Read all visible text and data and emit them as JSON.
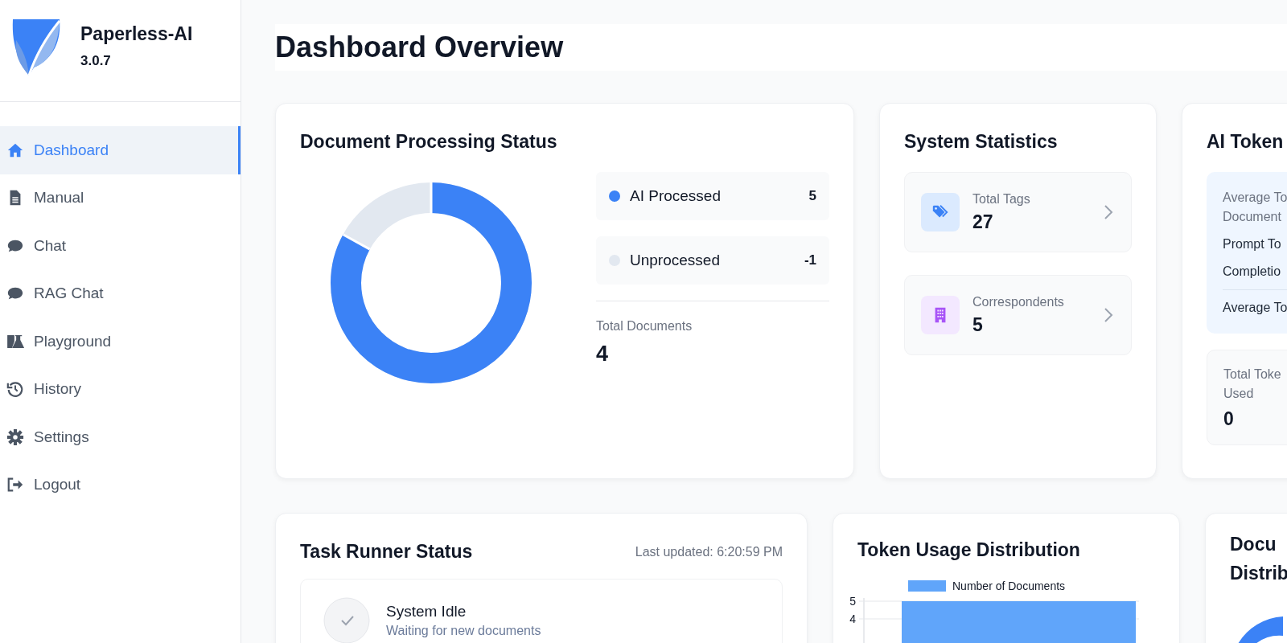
{
  "sidebar": {
    "app_name": "Paperless-AI",
    "version": "3.0.7",
    "items": [
      {
        "label": "Dashboard",
        "kind": "home",
        "selected": true
      },
      {
        "label": "Manual",
        "kind": "document",
        "selected": false
      },
      {
        "label": "Chat",
        "kind": "chat",
        "selected": false
      },
      {
        "label": "RAG Chat",
        "kind": "chat",
        "selected": false
      },
      {
        "label": "Playground",
        "kind": "flask",
        "selected": false
      },
      {
        "label": "History",
        "kind": "history",
        "selected": false
      },
      {
        "label": "Settings",
        "kind": "gear",
        "selected": false
      },
      {
        "label": "Logout",
        "kind": "logout",
        "selected": false
      }
    ]
  },
  "page_title": "Dashboard Overview",
  "document_status": {
    "title": "Document Processing Status",
    "donut": {
      "level": 0.83
    },
    "legend": [
      {
        "label": "AI Processed",
        "count": "5",
        "color": "#3b82f6"
      },
      {
        "label": "Unprocessed",
        "count": "-1",
        "color": "#e2e8f0"
      }
    ],
    "total_label": "Total Documents",
    "total": "4"
  },
  "system_statistics": {
    "title": "System Statistics",
    "items": [
      {
        "kind": "tags",
        "label": "Total Tags",
        "value": "27"
      },
      {
        "kind": "correspondents",
        "label": "Correspondents",
        "value": "5"
      }
    ]
  },
  "ai_tokens": {
    "title": "AI Token",
    "average_lines": [
      "Average To",
      "Document"
    ],
    "rows": [
      "Prompt To",
      "Completio"
    ],
    "footer_row": "Average To",
    "total_lines": [
      "Total Toke",
      "Used"
    ],
    "total_value": "0"
  },
  "task_runner": {
    "title": "Task Runner Status",
    "last_updated": "Last updated: 6:20:59 PM",
    "status_title": "System Idle",
    "status_subtitle": "Waiting for new documents"
  },
  "token_usage": {
    "title": "Token Usage Distribution",
    "legend_label": "Number of Documents",
    "axis_labels": [
      "5",
      "4"
    ]
  },
  "document_distribution": {
    "title_lines": [
      "Docu",
      "Distrib"
    ]
  }
}
